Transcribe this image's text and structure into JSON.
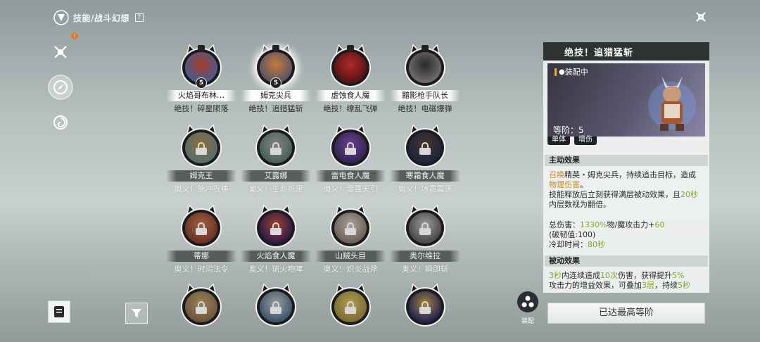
{
  "header": {
    "breadcrumb": "技能/战斗幻想",
    "help_label": "?"
  },
  "sidebar": {
    "notification_count": "!"
  },
  "cards": [
    {
      "name": "火焰哥布林…",
      "skill": "绝技！碎星陨落",
      "locked": false,
      "level": "5",
      "color": "#4a5a8a",
      "color2": "#a83a2a"
    },
    {
      "name": "姆克尖兵",
      "skill": "绝技！追猎猛斩",
      "locked": false,
      "level": "5",
      "color": "#5a5466",
      "color2": "#c87a3a",
      "selected": true
    },
    {
      "name": "虚蚀食人魔",
      "skill": "绝技！缭乱飞弹",
      "locked": false,
      "level": "",
      "color": "#5a1414",
      "color2": "#b02a2a"
    },
    {
      "name": "黯影枪手队长",
      "skill": "绝技！电磁爆弹",
      "locked": false,
      "level": "",
      "color": "#6e6a6a",
      "color2": "#2a2a2a"
    },
    {
      "name": "姆克王",
      "skill": "奥义！脉冲祝祷",
      "locked": true,
      "color": "#6a8a8a",
      "color2": "#b68a3a"
    },
    {
      "name": "艾露娜",
      "skill": "奥义！生命祈愿",
      "locked": true,
      "color": "#5a7a6a",
      "color2": "#a6a6a6"
    },
    {
      "name": "雷电食人魔",
      "skill": "奥义！雷霆天引",
      "locked": true,
      "color": "#3a2a6a",
      "color2": "#8a4ab6"
    },
    {
      "name": "寒霜食人魔",
      "skill": "奥义！冰霜震荡",
      "locked": true,
      "color": "#1e2a4a",
      "color2": "#5a3a2a"
    },
    {
      "name": "蒂娜",
      "skill": "奥义！时间法令",
      "locked": true,
      "color": "#8a3a2a",
      "color2": "#c87a4a"
    },
    {
      "name": "火焰食人魔",
      "skill": "奥义！琉火咆哮",
      "locked": true,
      "color": "#3a1a5a",
      "color2": "#c8502a"
    },
    {
      "name": "山贼头目",
      "skill": "奥义！炽炎战斧",
      "locked": true,
      "color": "#8a7a6a",
      "color2": "#d8d0c8"
    },
    {
      "name": "奥尔维拉",
      "skill": "奥义！瞬即斩",
      "locked": true,
      "color": "#5a5a5a",
      "color2": "#c8c8c8"
    },
    {
      "name": "",
      "skill": "",
      "locked": true,
      "color": "#8a6a4a",
      "color2": "#c8a66a"
    },
    {
      "name": "",
      "skill": "",
      "locked": true,
      "color": "#4a6a8a",
      "color2": "#c8c8c8"
    },
    {
      "name": "",
      "skill": "",
      "locked": true,
      "color": "#a0883a",
      "color2": "#e0c86a"
    },
    {
      "name": "",
      "skill": "",
      "locked": true,
      "color": "#2a2a6a",
      "color2": "#d8a83a"
    }
  ],
  "detail": {
    "title": "绝技！追猎猛斩",
    "equipped_label": "装配中",
    "level_label": "等阶：",
    "level_value": "5",
    "tags": [
      "单体",
      "增伤"
    ],
    "active_title": "主动效果",
    "active": {
      "p1_a": "召唤",
      "p1_b": "精英・姆克尖兵，持续追击目标，造成",
      "p1_c": "物理伤害",
      "p1_d": "。",
      "p2_a": "技能释放后立刻获得满层被动效果，且",
      "p2_b": "20秒",
      "p2_c": "内层数视为翻倍。",
      "dmg_a": "总伤害：",
      "dmg_b": "1330%",
      "dmg_c": "物/魔攻击力+",
      "dmg_d": "60",
      "break": "(破韧值:100)",
      "cd_a": "冷却时间：",
      "cd_b": "80秒"
    },
    "passive_title": "被动效果",
    "passive": {
      "a": "3秒",
      "b": "内连续造成",
      "c": "10次",
      "d": "伤害，获得提升",
      "e": "5%",
      "f": "攻击力的增益效果，可叠加",
      "g": "3层",
      "h": "，持续",
      "i": "5秒"
    }
  },
  "buttons": {
    "max_level": "已达最高等阶",
    "equip": "装配"
  }
}
